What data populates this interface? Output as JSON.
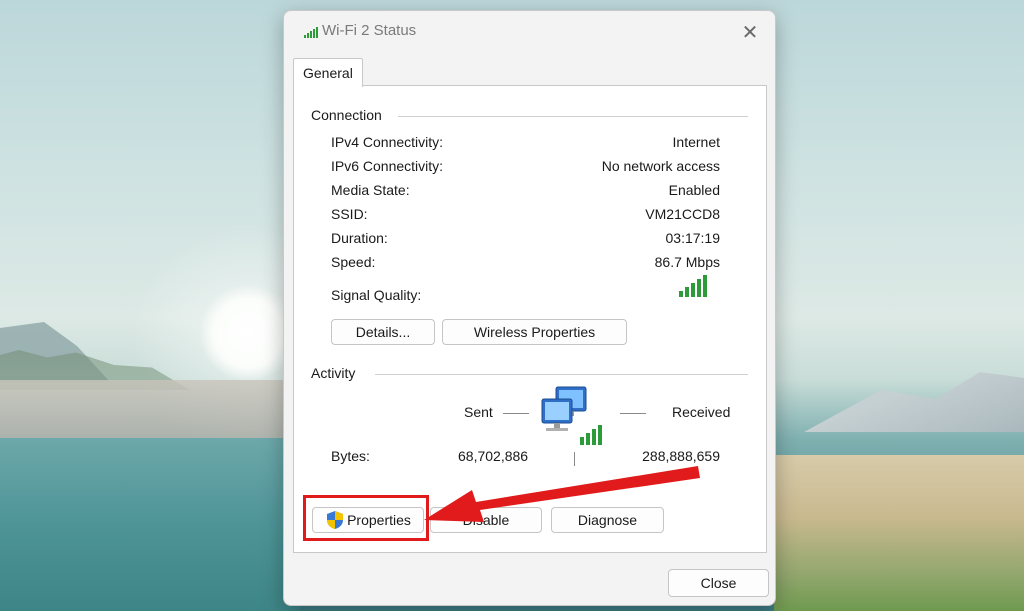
{
  "window": {
    "title": "Wi-Fi 2 Status",
    "close_glyph": "✕"
  },
  "tabs": [
    {
      "label": "General",
      "selected": true
    }
  ],
  "connection": {
    "heading": "Connection",
    "rows": [
      {
        "label": "IPv4 Connectivity:",
        "value": "Internet"
      },
      {
        "label": "IPv6 Connectivity:",
        "value": "No network access"
      },
      {
        "label": "Media State:",
        "value": "Enabled"
      },
      {
        "label": "SSID:",
        "value": "VM21CCD8"
      },
      {
        "label": "Duration:",
        "value": "03:17:19"
      },
      {
        "label": "Speed:",
        "value": "86.7 Mbps"
      }
    ],
    "signal_quality": {
      "label": "Signal Quality:",
      "bars_lit": 5,
      "bars_total": 5,
      "color": "#2e9b3a"
    },
    "details_button": "Details...",
    "wireless_properties_button": "Wireless Properties"
  },
  "activity": {
    "heading": "Activity",
    "sent_label": "Sent",
    "received_label": "Received",
    "bytes_label": "Bytes:",
    "bytes_sent": "68,702,886",
    "bytes_received": "288,888,659"
  },
  "actions": {
    "properties_button": "Properties",
    "disable_button": "Disable",
    "diagnose_button": "Diagnose",
    "shield_icon": "uac-shield-icon"
  },
  "footer": {
    "close_button": "Close"
  },
  "annotation": {
    "highlight_color": "#e11b1b"
  }
}
